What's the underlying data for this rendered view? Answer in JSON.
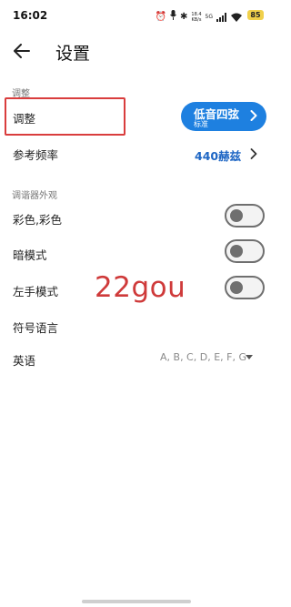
{
  "status_bar": {
    "time": "16:02",
    "data_speed_value": "18.4",
    "data_speed_unit": "KB/s",
    "network": "5G",
    "battery": "85"
  },
  "header": {
    "title": "设置"
  },
  "sections": {
    "adjust_header": "调整",
    "appearance_header": "调谐器外观"
  },
  "tuning": {
    "label": "调整",
    "value_main": "低音四弦",
    "value_sub": "标准"
  },
  "reference_freq": {
    "label": "参考频率",
    "value": "440赫兹"
  },
  "appearance": {
    "color_label": "彩色,彩色",
    "dark_label": "暗模式",
    "left_hand_label": "左手模式",
    "color_on": false,
    "dark_on": false,
    "left_hand_on": false
  },
  "notation": {
    "header": "符号语言",
    "language_label": "英语",
    "language_value": "A, B, C, D, E, F, G"
  },
  "overlay": {
    "watermark": "22gou"
  },
  "colors": {
    "accent": "#1e80e0",
    "link": "#1e66c4",
    "highlight": "#d93d3d"
  }
}
